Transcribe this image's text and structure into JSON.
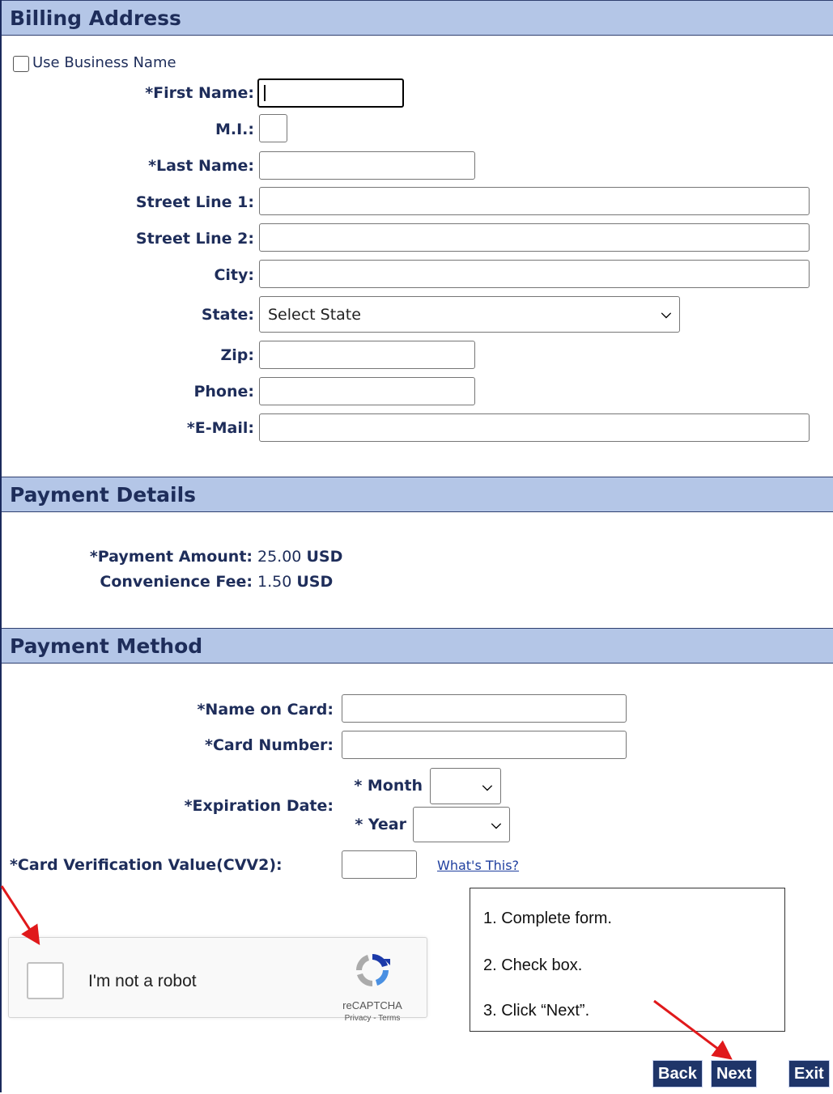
{
  "billing": {
    "heading": "Billing Address",
    "use_business_name": "Use Business Name",
    "first_name_label": "*First Name:",
    "mi_label": "M.I.:",
    "last_name_label": "*Last Name:",
    "street1_label": "Street Line 1:",
    "street2_label": "Street Line 2:",
    "city_label": "City:",
    "state_label": "State:",
    "state_value": "Select State",
    "zip_label": "Zip:",
    "phone_label": "Phone:",
    "email_label": "*E-Mail:"
  },
  "payment_details": {
    "heading": "Payment Details",
    "amount_label": "*Payment Amount:",
    "amount_value": "25.00",
    "amount_currency": "USD",
    "fee_label": "Convenience Fee:",
    "fee_value": "1.50",
    "fee_currency": "USD"
  },
  "payment_method": {
    "heading": "Payment Method",
    "name_on_card_label": "*Name on Card:",
    "card_number_label": "*Card Number:",
    "expiration_label": "*Expiration Date:",
    "month_label": "* Month",
    "year_label": "* Year",
    "cvv_label": "*Card Verification Value(CVV2):",
    "whats_this": "What's This?"
  },
  "recaptcha": {
    "label": "I'm not a robot",
    "brand": "reCAPTCHA",
    "privacy": "Privacy",
    "separator": " - ",
    "terms": "Terms"
  },
  "instructions": {
    "step1": "1. Complete form.",
    "step2": "2. Check box.",
    "step3": "3. Click “Next”."
  },
  "buttons": {
    "back": "Back",
    "next": "Next",
    "exit": "Exit"
  },
  "colors": {
    "section_bar": "#b4c6e7",
    "label_text": "#1e2d5a",
    "button_bg": "#1f3569",
    "annotation_arrow": "#e0191b"
  }
}
